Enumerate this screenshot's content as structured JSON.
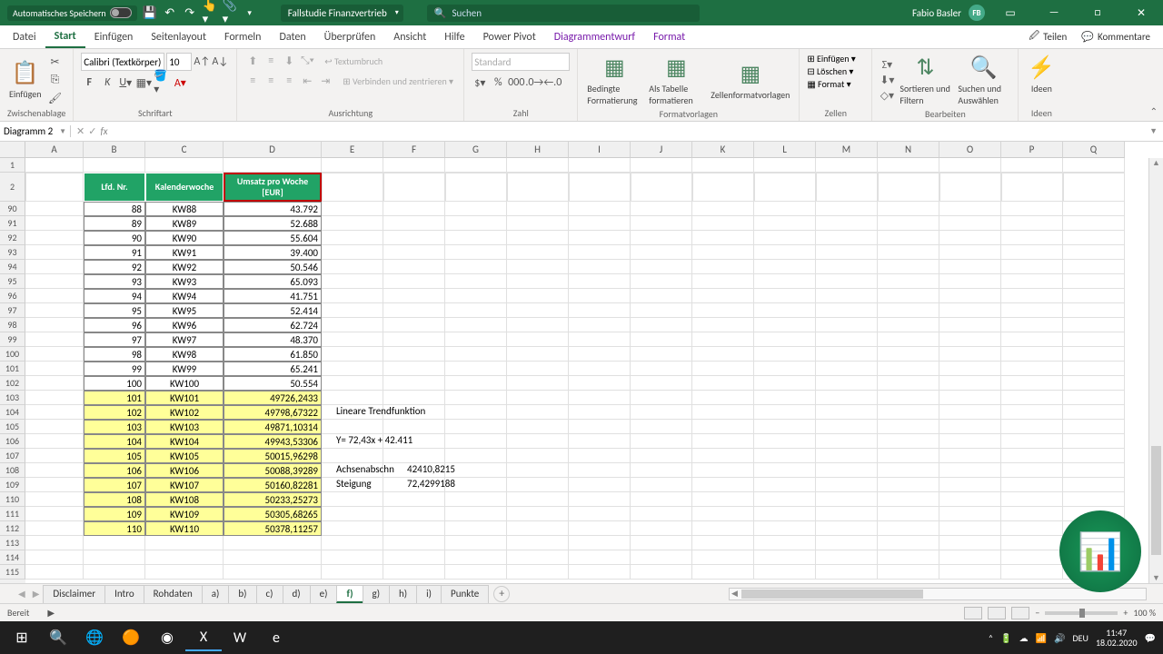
{
  "titleBar": {
    "autosave": "Automatisches Speichern",
    "fileName": "Fallstudie Finanzvertrieb",
    "searchPlaceholder": "Suchen",
    "userName": "Fabio Basler",
    "userInitials": "FB"
  },
  "ribbonTabs": [
    "Datei",
    "Start",
    "Einfügen",
    "Seitenlayout",
    "Formeln",
    "Daten",
    "Überprüfen",
    "Ansicht",
    "Hilfe",
    "Power Pivot",
    "Diagrammentwurf",
    "Format"
  ],
  "ribbonActive": 1,
  "share": "Teilen",
  "comments": "Kommentare",
  "ribbon": {
    "clipboard": {
      "paste": "Einfügen",
      "label": "Zwischenablage"
    },
    "font": {
      "name": "Calibri (Textkörper)",
      "size": "10",
      "label": "Schriftart"
    },
    "align": {
      "wrap": "Textumbruch",
      "merge": "Verbinden und zentrieren",
      "label": "Ausrichtung"
    },
    "number": {
      "format": "Standard",
      "label": "Zahl"
    },
    "styles": {
      "cond": "Bedingte Formatierung",
      "table": "Als Tabelle formatieren",
      "cell": "Zellenformatvorlagen",
      "label": "Formatvorlagen"
    },
    "cells": {
      "insert": "Einfügen",
      "delete": "Löschen",
      "format": "Format",
      "label": "Zellen"
    },
    "editing": {
      "sort": "Sortieren und Filtern",
      "find": "Suchen und Auswählen",
      "label": "Bearbeiten"
    },
    "ideas": {
      "btn": "Ideen",
      "label": "Ideen"
    }
  },
  "nameBox": "Diagramm 2",
  "fx": "fx",
  "columns": [
    "A",
    "B",
    "C",
    "D",
    "E",
    "F",
    "G",
    "H",
    "I",
    "J",
    "K",
    "L",
    "M",
    "N",
    "O",
    "P",
    "Q"
  ],
  "headerRow": {
    "b": "Lfd. Nr.",
    "c": "Kalenderwoche",
    "d": "Umsatz pro Woche [EUR]"
  },
  "frozenRows": [
    "1",
    "2"
  ],
  "dataRows": [
    {
      "r": "90",
      "b": "88",
      "c": "KW88",
      "d": "43.792",
      "y": false
    },
    {
      "r": "91",
      "b": "89",
      "c": "KW89",
      "d": "52.688",
      "y": false
    },
    {
      "r": "92",
      "b": "90",
      "c": "KW90",
      "d": "55.604",
      "y": false
    },
    {
      "r": "93",
      "b": "91",
      "c": "KW91",
      "d": "39.400",
      "y": false
    },
    {
      "r": "94",
      "b": "92",
      "c": "KW92",
      "d": "50.546",
      "y": false
    },
    {
      "r": "95",
      "b": "93",
      "c": "KW93",
      "d": "65.093",
      "y": false
    },
    {
      "r": "96",
      "b": "94",
      "c": "KW94",
      "d": "41.751",
      "y": false
    },
    {
      "r": "97",
      "b": "95",
      "c": "KW95",
      "d": "52.414",
      "y": false
    },
    {
      "r": "98",
      "b": "96",
      "c": "KW96",
      "d": "62.724",
      "y": false
    },
    {
      "r": "99",
      "b": "97",
      "c": "KW97",
      "d": "48.370",
      "y": false
    },
    {
      "r": "100",
      "b": "98",
      "c": "KW98",
      "d": "61.850",
      "y": false
    },
    {
      "r": "101",
      "b": "99",
      "c": "KW99",
      "d": "65.241",
      "y": false
    },
    {
      "r": "102",
      "b": "100",
      "c": "KW100",
      "d": "50.554",
      "y": false
    },
    {
      "r": "103",
      "b": "101",
      "c": "KW101",
      "d": "49726,2433",
      "y": true
    },
    {
      "r": "104",
      "b": "102",
      "c": "KW102",
      "d": "49798,67322",
      "y": true
    },
    {
      "r": "105",
      "b": "103",
      "c": "KW103",
      "d": "49871,10314",
      "y": true
    },
    {
      "r": "106",
      "b": "104",
      "c": "KW104",
      "d": "49943,53306",
      "y": true
    },
    {
      "r": "107",
      "b": "105",
      "c": "KW105",
      "d": "50015,96298",
      "y": true
    },
    {
      "r": "108",
      "b": "106",
      "c": "KW106",
      "d": "50088,39289",
      "y": true
    },
    {
      "r": "109",
      "b": "107",
      "c": "KW107",
      "d": "50160,82281",
      "y": true
    },
    {
      "r": "110",
      "b": "108",
      "c": "KW108",
      "d": "50233,25273",
      "y": true
    },
    {
      "r": "111",
      "b": "109",
      "c": "KW109",
      "d": "50305,68265",
      "y": true
    },
    {
      "r": "112",
      "b": "110",
      "c": "KW110",
      "d": "50378,11257",
      "y": true
    }
  ],
  "emptyRows": [
    "113",
    "114",
    "115"
  ],
  "sideNotes": {
    "title": "Lineare Trendfunktion",
    "eq": "Y= 72,43x + 42.411",
    "intLabel": "Achsenabschn",
    "intVal": "42410,8215",
    "slopeLabel": "Steigung",
    "slopeVal": "72,4299188"
  },
  "sheetTabs": [
    "Disclaimer",
    "Intro",
    "Rohdaten",
    "a)",
    "b)",
    "c)",
    "d)",
    "e)",
    "f)",
    "g)",
    "h)",
    "i)",
    "Punkte"
  ],
  "activeSheet": 8,
  "status": {
    "ready": "Bereit",
    "zoom": "100 %"
  },
  "tray": {
    "lang": "DEU",
    "time": "11:47",
    "date": "18.02.2020"
  }
}
